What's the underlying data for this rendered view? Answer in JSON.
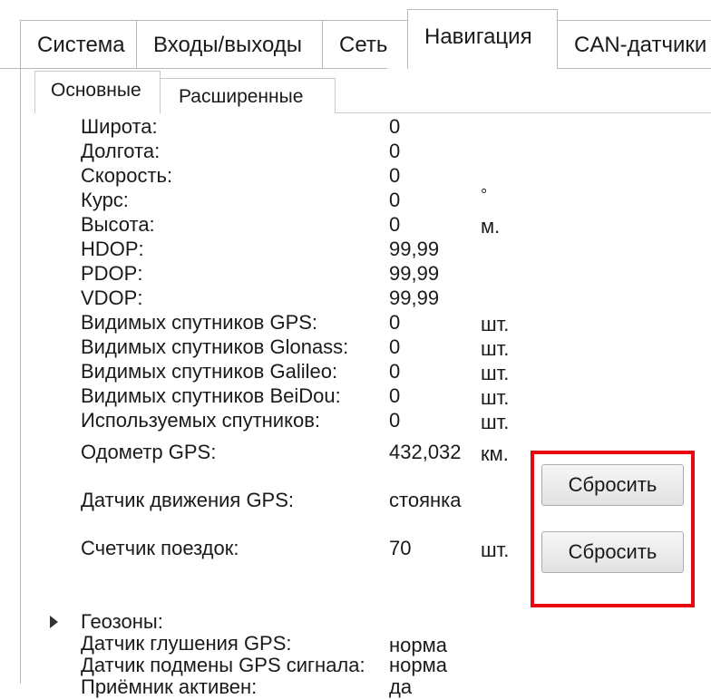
{
  "main_tabs": [
    "Система",
    "Входы/выходы",
    "Сеть",
    "Навигация",
    "CAN-датчики"
  ],
  "active_main_tab": "Навигация",
  "sub_tabs": [
    "Основные",
    "Расширенные"
  ],
  "active_sub_tab": "Основные",
  "rows": {
    "latitude": {
      "label": "Широта:",
      "value": "0"
    },
    "longitude": {
      "label": "Долгота:",
      "value": "0"
    },
    "speed": {
      "label": "Скорость:",
      "value": "0"
    },
    "course": {
      "label": "Курс:",
      "value": "0",
      "unit": "°"
    },
    "altitude": {
      "label": "Высота:",
      "value": "0",
      "unit": "м."
    },
    "hdop": {
      "label": "HDOP:",
      "value": "99,99"
    },
    "pdop": {
      "label": "PDOP:",
      "value": "99,99"
    },
    "vdop": {
      "label": "VDOP:",
      "value": "99,99"
    },
    "sats_gps": {
      "label": "Видимых спутников GPS:",
      "value": "0",
      "unit": "шт."
    },
    "sats_glonass": {
      "label": "Видимых спутников Glonass:",
      "value": "0",
      "unit": "шт."
    },
    "sats_galileo": {
      "label": "Видимых спутников Galileo:",
      "value": "0",
      "unit": "шт."
    },
    "sats_beidou": {
      "label": "Видимых спутников BeiDou:",
      "value": "0",
      "unit": "шт."
    },
    "sats_used": {
      "label": "Используемых спутников:",
      "value": "0",
      "unit": "шт."
    },
    "odometer": {
      "label": "Одометр GPS:",
      "value": "432,032",
      "unit": "км.",
      "button": "Сбросить"
    },
    "motion_sensor": {
      "label": "Датчик движения GPS:",
      "value": "стоянка"
    },
    "trip_counter": {
      "label": "Счетчик поездок:",
      "value": "70",
      "unit": "шт.",
      "button": "Сбросить"
    },
    "geozones": {
      "label": "Геозоны:"
    },
    "jamming_sensor": {
      "label": "Датчик глушения GPS:",
      "value": "норма"
    },
    "spoofing_sensor": {
      "label": "Датчик подмены GPS сигнала:",
      "value": "норма"
    },
    "receiver_active": {
      "label": "Приёмник активен:",
      "value": "да"
    }
  },
  "colors": {
    "highlight": "#e8070d",
    "tab_border": "#b9b9b9"
  }
}
